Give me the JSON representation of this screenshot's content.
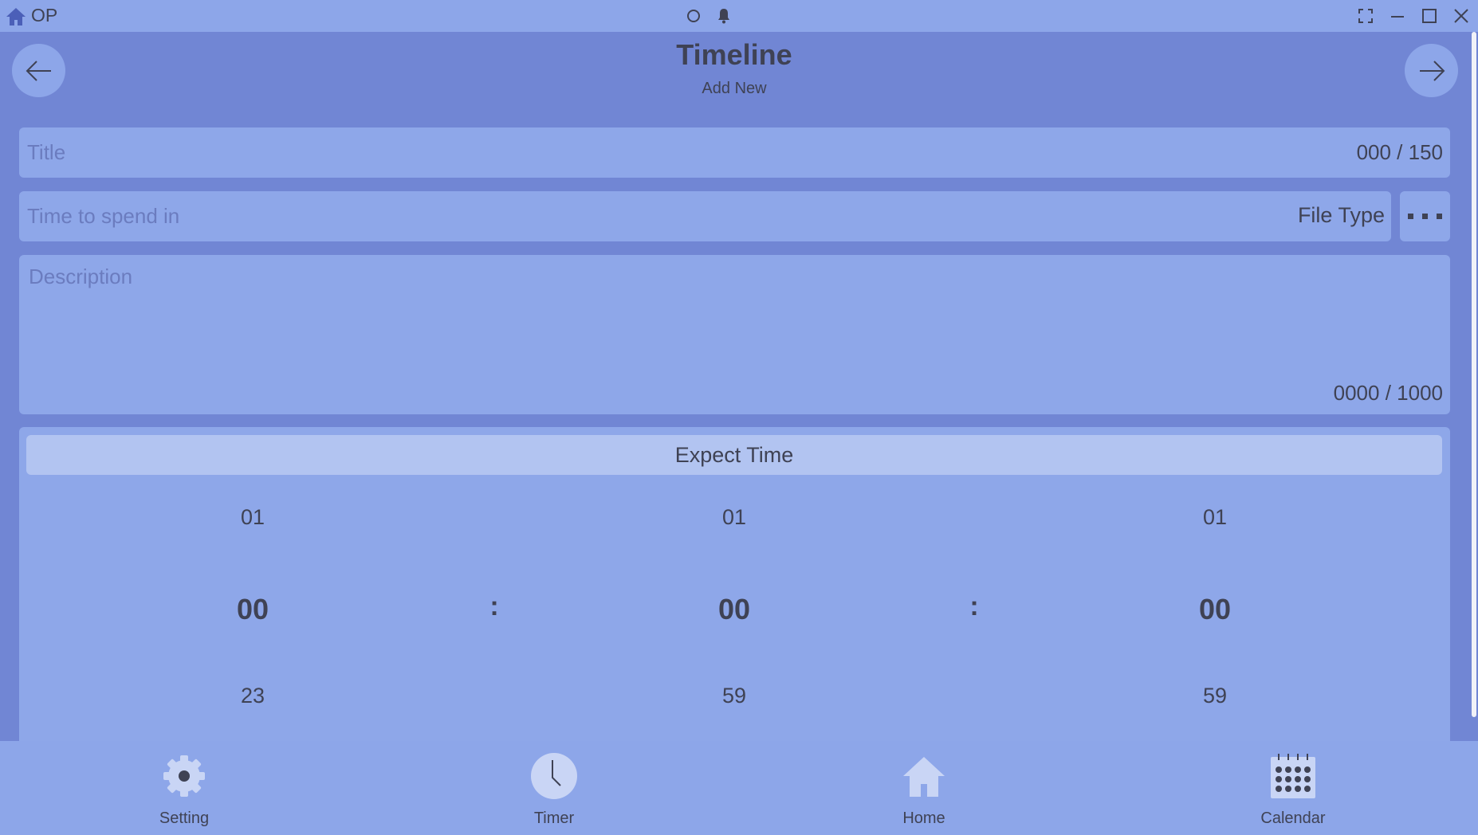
{
  "titlebar": {
    "app_name": "OP"
  },
  "header": {
    "title": "Timeline",
    "subtitle": "Add New"
  },
  "form": {
    "title_placeholder": "Title",
    "title_counter": "000 / 150",
    "time_placeholder": "Time to spend in",
    "file_type_label": "File Type",
    "description_placeholder": "Description",
    "description_counter": "0000 / 1000"
  },
  "expect_time": {
    "label": "Expect Time",
    "separator": ":",
    "hours": {
      "prev": "01",
      "current": "00",
      "next": "23"
    },
    "minutes": {
      "prev": "01",
      "current": "00",
      "next": "59"
    },
    "seconds": {
      "prev": "01",
      "current": "00",
      "next": "59"
    }
  },
  "bottom_nav": {
    "items": [
      {
        "label": "Setting",
        "icon": "gear-icon"
      },
      {
        "label": "Timer",
        "icon": "clock-icon"
      },
      {
        "label": "Home",
        "icon": "home-icon"
      },
      {
        "label": "Calendar",
        "icon": "calendar-icon"
      }
    ]
  },
  "colors": {
    "background": "#7186d4",
    "surface": "#8da6e9",
    "header_band": "#b2c4f1",
    "text": "#3f4254",
    "placeholder": "#6b7cbf"
  }
}
